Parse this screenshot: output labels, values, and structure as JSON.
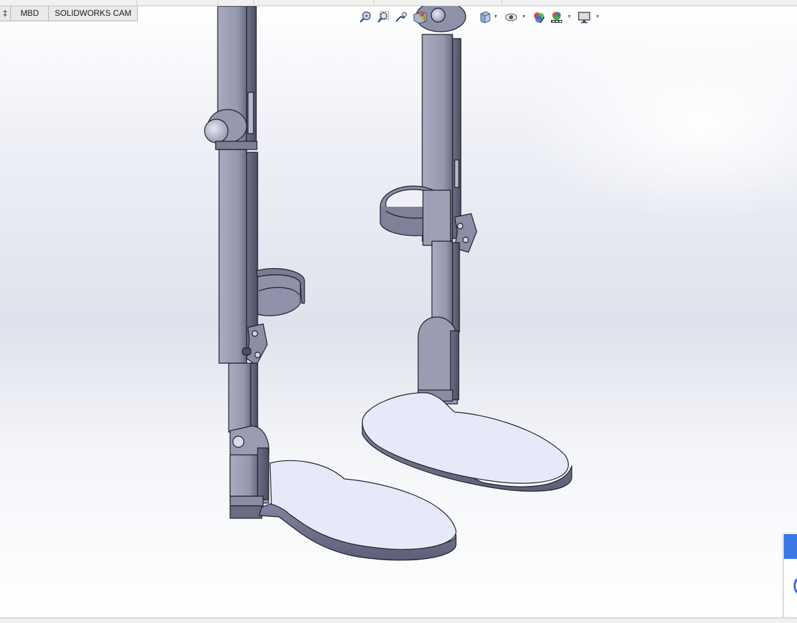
{
  "window": {
    "app": "SOLIDWORKS"
  },
  "command_manager": {
    "tabs": [
      {
        "label": "‡",
        "active": false
      },
      {
        "label": "MBD",
        "active": false
      },
      {
        "label": "SOLIDWORKS CAM",
        "active": false
      }
    ]
  },
  "heads_up_toolbar": {
    "tools": [
      {
        "icon": "zoom-to-fit-icon"
      },
      {
        "icon": "zoom-to-area-icon"
      },
      {
        "icon": "previous-view-icon"
      },
      {
        "icon": "section-view-icon"
      },
      {
        "icon": "view-orientation-icon",
        "has_dropdown": true
      },
      {
        "icon": "hide-show-items-icon",
        "has_dropdown": true
      },
      {
        "icon": "edit-appearance-icon"
      },
      {
        "icon": "apply-scene-icon",
        "has_dropdown": true
      },
      {
        "icon": "view-settings-icon",
        "has_dropdown": true
      }
    ]
  },
  "viewport": {
    "model": "leg-orthosis-assembly",
    "background_colors": [
      "#ffffff",
      "#dfe2ec"
    ]
  },
  "colors": {
    "part_gray": "#9a9cb2",
    "part_light": "#e6eaf8",
    "edge": "#1e1e28",
    "accent_blue": "#3a78e6"
  }
}
